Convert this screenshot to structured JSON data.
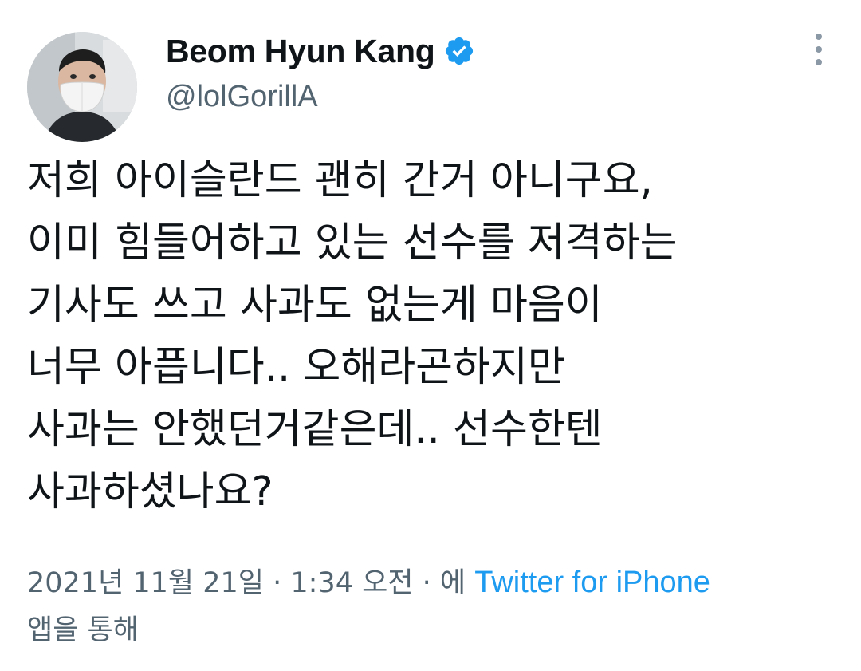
{
  "user": {
    "display_name": "Beom Hyun Kang",
    "handle": "@lolGorillA",
    "verified": true
  },
  "tweet": {
    "lines": [
      "저희 아이슬란드 괜히 간거 아니구요,",
      "이미 힘들어하고 있는 선수를 저격하는",
      "기사도 쓰고 사과도 없는게 마음이",
      "너무 아픕니다.. 오해라곤하지만",
      "사과는 안했던거같은데.. 선수한텐",
      "사과하셨나요?"
    ]
  },
  "meta": {
    "date_time": "2021년 11월 21일 · 1:34 오전 · 에 ",
    "source": "Twitter for iPhone",
    "suffix": "앱을 통해"
  },
  "colors": {
    "accent": "#1d9bf0",
    "secondary_text": "#536471",
    "primary_text": "#0f1419"
  },
  "icons": {
    "verified": "verified-badge-icon",
    "more": "more-options-icon"
  }
}
